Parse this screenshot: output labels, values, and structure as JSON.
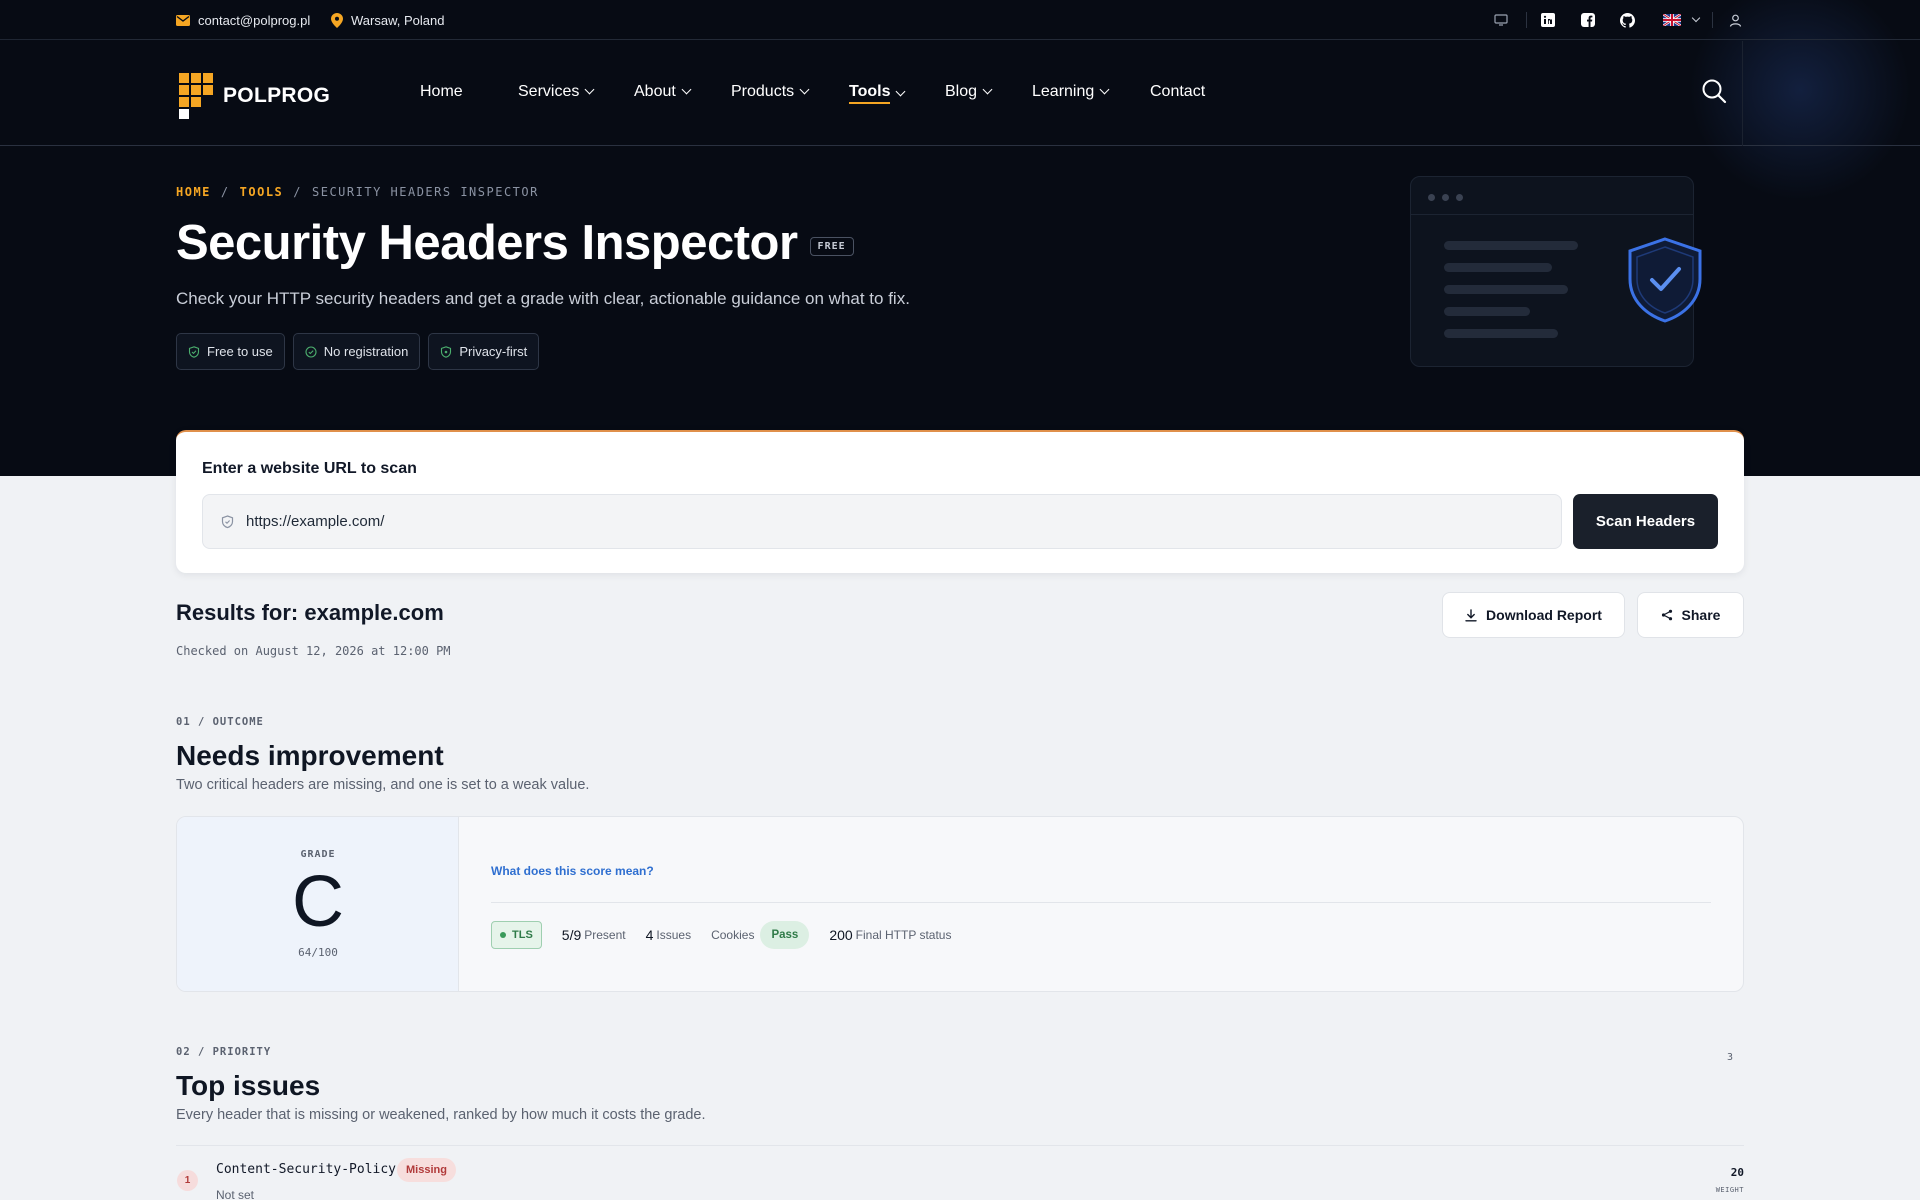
{
  "topbar": {
    "email": "contact@polprog.pl",
    "location": "Warsaw, Poland"
  },
  "brand": {
    "name": "POLPROG",
    "accent_color": "#f5a623"
  },
  "nav": {
    "items": [
      {
        "label": "Home"
      },
      {
        "label": "Services"
      },
      {
        "label": "About"
      },
      {
        "label": "Products"
      },
      {
        "label": "Tools",
        "active": true
      },
      {
        "label": "Blog"
      },
      {
        "label": "Learning"
      },
      {
        "label": "Contact"
      }
    ]
  },
  "breadcrumb": {
    "home": "HOME",
    "tools": "TOOLS",
    "current": "SECURITY HEADERS INSPECTOR",
    "separator": "/"
  },
  "hero": {
    "title": "Security Headers Inspector",
    "badge": "FREE",
    "subtitle": "Check your HTTP security headers and get a grade with clear, actionable guidance on what to fix.",
    "chips": [
      "Free to use",
      "No registration",
      "Privacy-first"
    ]
  },
  "scan": {
    "label": "Enter a website URL to scan",
    "url_value": "https://example.com/",
    "button": "Scan Headers"
  },
  "results": {
    "title": "Results for: example.com",
    "checked": "Checked on August 12, 2026 at 12:00 PM",
    "download": "Download Report",
    "share": "Share"
  },
  "outcome": {
    "section_label": "01 / OUTCOME",
    "title": "Needs improvement",
    "description": "Two critical headers are missing, and one is set to a weak value.",
    "grade_label": "GRADE",
    "grade": "C",
    "score": "64/100",
    "score_link": "What does this score mean?",
    "tls": "TLS",
    "present_value": "5/9",
    "present_label": "Present",
    "issues_value": "4",
    "issues_label": "Issues",
    "cookies_label": "Cookies",
    "cookies_status": "Pass",
    "http_value": "200",
    "http_label": "Final HTTP status"
  },
  "priority": {
    "section_label": "02 / PRIORITY",
    "title": "Top issues",
    "description": "Every header that is missing or weakened, ranked by how much it costs the grade.",
    "count": "3",
    "issues": [
      {
        "rank": "1",
        "name": "Content-Security-Policy",
        "status": "Missing",
        "detail": "Not set",
        "weight": "20",
        "weight_label": "WEIGHT"
      }
    ]
  }
}
